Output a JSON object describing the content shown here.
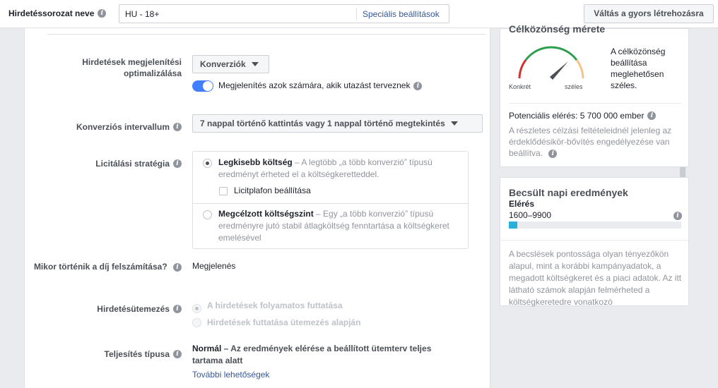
{
  "topbar": {
    "label": "Hirdetéssorozat neve",
    "name_value": "HU - 18+",
    "special_settings": "Speciális beállítások",
    "quick_create": "Váltás a gyors létrehozásra"
  },
  "optimization": {
    "label": "Hirdetések megjelenítési optimalizálása",
    "selected": "Konverziók",
    "toggle_on": true,
    "toggle_text": "Megjelenítés azok számára, akik utazást terveznek"
  },
  "conversion_window": {
    "label": "Konverziós intervallum",
    "selected": "7 nappal történő kattintás vagy 1 nappal történő megtekintés"
  },
  "bid_strategy": {
    "label": "Licitálási stratégia",
    "lowest_cost": {
      "title": "Legkisebb költség",
      "desc": " – A legtöbb „a több konverzió” típusú eredményt érheted el a költségkeretteddel.",
      "selected": true
    },
    "bid_cap_label": "Licitplafon beállítása",
    "target_cost": {
      "title": "Megcélzott költségszint",
      "desc": " – Egy „a több konverzió” típusú eredményre jutó stabil átlagköltség fenntartása a költségkeret emelésével",
      "selected": false
    }
  },
  "billing": {
    "label": "Mikor történik a díj felszámítása?",
    "value": "Megjelenés"
  },
  "scheduling": {
    "label": "Hirdetésütemezés",
    "option1": "A hirdetések folyamatos futtatása",
    "option2": "Hirdetések futtatása ütemezés alapján"
  },
  "delivery_type": {
    "label": "Teljesítés típusa",
    "value_bold": "Normál",
    "value_rest": " – Az eredmények elérése a beállított ütemterv teljes tartama alatt",
    "more_link": "További lehetőségek"
  },
  "audience_card": {
    "title": "Célközönség mérete",
    "desc": "A célközönség beállítása meglehetősen széles.",
    "gauge_left": "Konkrét",
    "gauge_right": "széles",
    "potential_reach": "Potenciális elérés: 5 700 000 ember",
    "note": "A részletes célzási feltételeidnél jelenleg az érdeklődésikör-bővítés engedélyezése van beállítva."
  },
  "estimate_card": {
    "title": "Becsült napi eredmények",
    "metric": "Elérés",
    "range": "1600–9900",
    "bar_fraction": 0.05,
    "note": "A becslések pontossága olyan tényezőkön alapul, mint a korábbi kampányadatok, a megadott költségkeret és a piaci adatok. Az itt látható számok alapján felmérheted a költségkeretedre vonatkozó"
  },
  "colors": {
    "accent": "#4080ff",
    "link": "#365899",
    "bar": "#28b0d8",
    "gauge_red": "#d32f2f",
    "gauge_green": "#2e9e4f",
    "gauge_orange": "#f5c28a"
  }
}
